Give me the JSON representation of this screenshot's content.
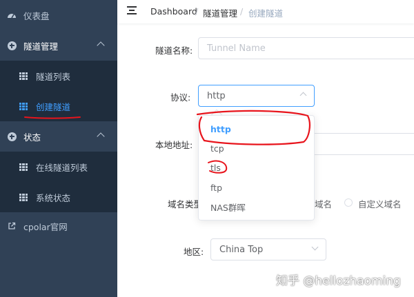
{
  "sidebar": {
    "dashboard": "仪表盘",
    "tunnel_mgmt": "隧道管理",
    "tunnel_list": "隧道列表",
    "create_tunnel": "创建隧道",
    "status": "状态",
    "online_tunnels": "在线隧道列表",
    "system_status": "系统状态",
    "cpolar_site": "cpolar官网"
  },
  "breadcrumb": {
    "home": "Dashboard",
    "sep": "/",
    "section": "隧道管理",
    "current": "创建隧道"
  },
  "form": {
    "tunnel_name_label": "隧道名称:",
    "tunnel_name_placeholder": "Tunnel Name",
    "protocol_label": "协议:",
    "protocol_value": "http",
    "local_addr_label": "本地地址:",
    "domain_type_label": "域名类型",
    "domain_option_partial": "域名",
    "domain_option_custom": "自定义域名",
    "region_label": "地区:",
    "region_value": "China Top"
  },
  "protocol_options": [
    "http",
    "tcp",
    "tls",
    "ftp",
    "NAS群晖"
  ],
  "selected_protocol": "http",
  "watermark": "知乎 @hellozhaoming",
  "colors": {
    "sidebar_bg": "#304156",
    "submenu_bg": "#1f2d3d",
    "accent": "#409eff",
    "annotation_red": "#e8141c"
  }
}
